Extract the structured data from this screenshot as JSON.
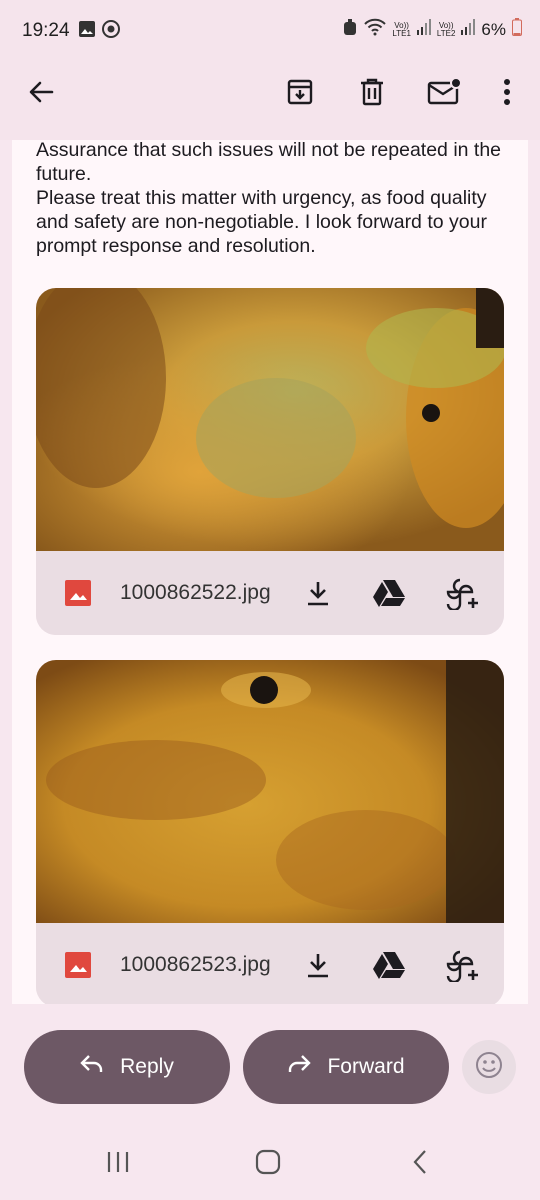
{
  "status_bar": {
    "time": "19:24",
    "sim1_label": "Vo))\nLTE1",
    "sim2_label": "Vo))\nLTE2",
    "battery": "6%",
    "icons": [
      "gallery-icon",
      "whatsapp-icon",
      "alarm-icon",
      "wifi-icon",
      "signal-icon",
      "battery-icon"
    ]
  },
  "toolbar": {
    "icons": [
      "back-arrow-icon",
      "archive-icon",
      "delete-icon",
      "mark-unread-icon",
      "more-options-icon"
    ]
  },
  "email": {
    "body": "Assurance that such issues will not be repeated in the future.\nPlease treat this matter with urgency, as food quality and safety are non-negotiable. I look forward to your prompt response and resolution."
  },
  "attachments": [
    {
      "filename": "1000862522.jpg",
      "icons": [
        "image-file-icon",
        "download-icon",
        "drive-icon",
        "add-to-photos-icon"
      ]
    },
    {
      "filename": "1000862523.jpg",
      "icons": [
        "image-file-icon",
        "download-icon",
        "drive-icon",
        "add-to-photos-icon"
      ]
    }
  ],
  "actions": {
    "reply_label": "Reply",
    "forward_label": "Forward",
    "icons": [
      "reply-icon",
      "forward-icon",
      "emoji-icon"
    ]
  },
  "nav": {
    "icons": [
      "recent-apps-icon",
      "home-icon",
      "back-icon"
    ]
  },
  "colors": {
    "background": "#f7e7ef",
    "content_background": "#fff7fa",
    "button_fill": "#6d5865",
    "attachment_bar": "#eadde3",
    "file_icon_red": "#e0483e"
  }
}
